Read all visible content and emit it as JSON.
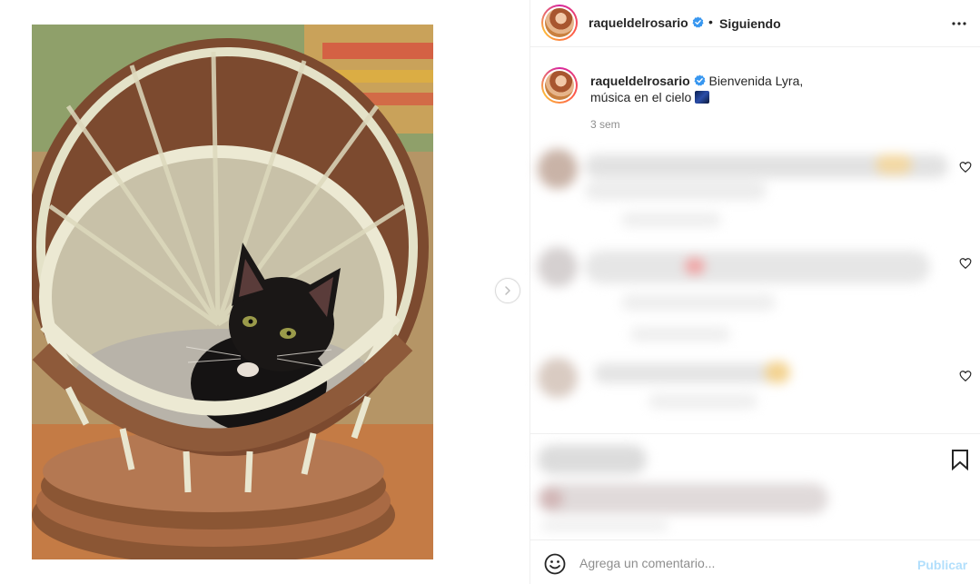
{
  "post": {
    "author": "raqueldelrosario",
    "follow_status": "Siguiendo",
    "separator": "•",
    "caption_line1": "Bienvenida Lyra,",
    "caption_line2": "música en el cielo",
    "caption_emoji": "night-sky-emoji",
    "time_ago": "3 sem",
    "verified_icon": "verified-badge-icon",
    "verified_color": "#3897f0"
  },
  "media": {
    "subject": "black-kitten-in-wicker-basket",
    "next_icon": "chevron-right-icon"
  },
  "comments": {
    "like_icon": "heart-icon"
  },
  "actions": {
    "save_icon": "bookmark-icon"
  },
  "comment_box": {
    "placeholder": "Agrega un comentario...",
    "publish_label": "Publicar",
    "emoji_icon": "smile-icon",
    "publish_color": "#b2dffc"
  }
}
